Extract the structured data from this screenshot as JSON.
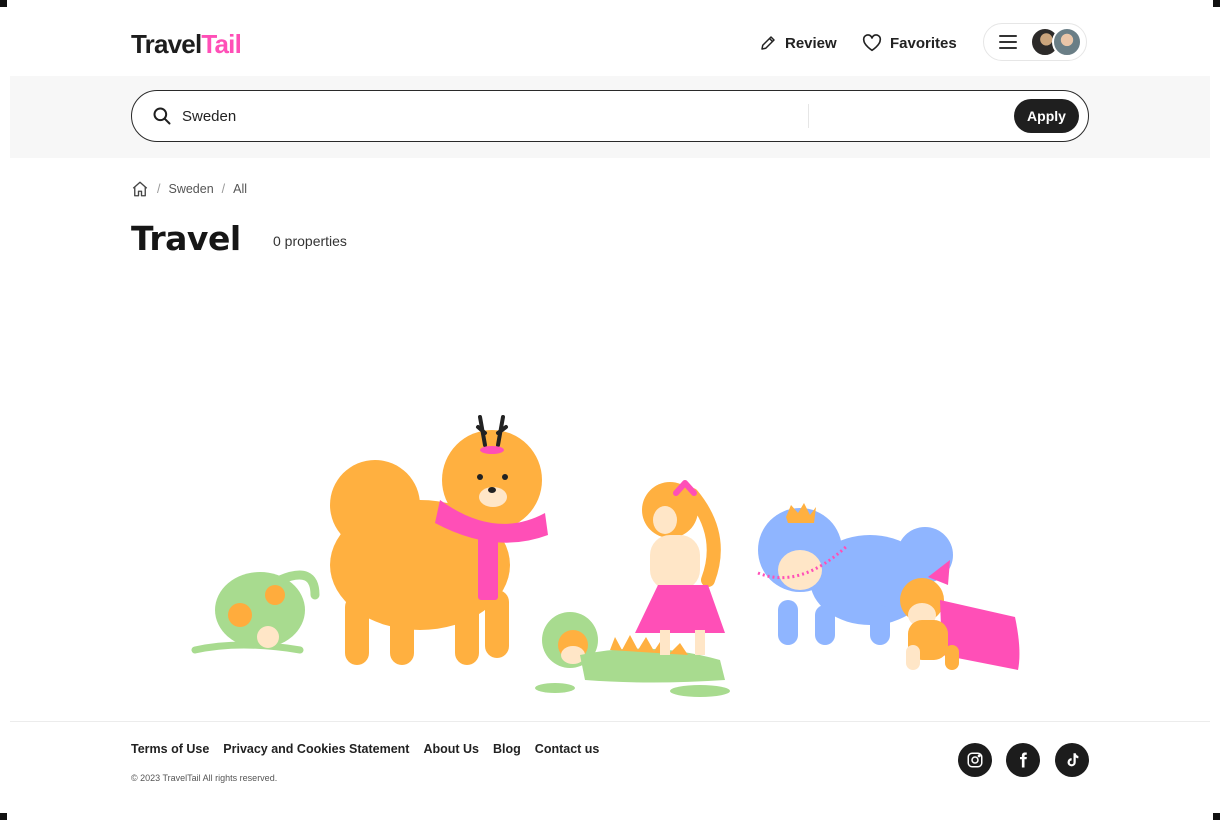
{
  "header": {
    "logo_part1": "Travel",
    "logo_part2": "Tail",
    "review_label": "Review",
    "favorites_label": "Favorites"
  },
  "search": {
    "value": "Sweden",
    "apply_label": "Apply"
  },
  "breadcrumb": {
    "items": [
      "Sweden",
      "All"
    ],
    "separator": "/"
  },
  "main": {
    "title": "Travel",
    "count_text": "0 properties"
  },
  "footer": {
    "links": [
      "Terms of Use",
      "Privacy and Cookies Statement",
      "About Us",
      "Blog",
      "Contact us"
    ],
    "copyright": "© 2023 TravelTail All rights reserved.",
    "social": [
      "instagram-icon",
      "facebook-icon",
      "tiktok-icon"
    ]
  },
  "colors": {
    "accent_pink": "#ff4fb7",
    "dark": "#1f1f1f",
    "search_band": "#f7f7f7"
  }
}
